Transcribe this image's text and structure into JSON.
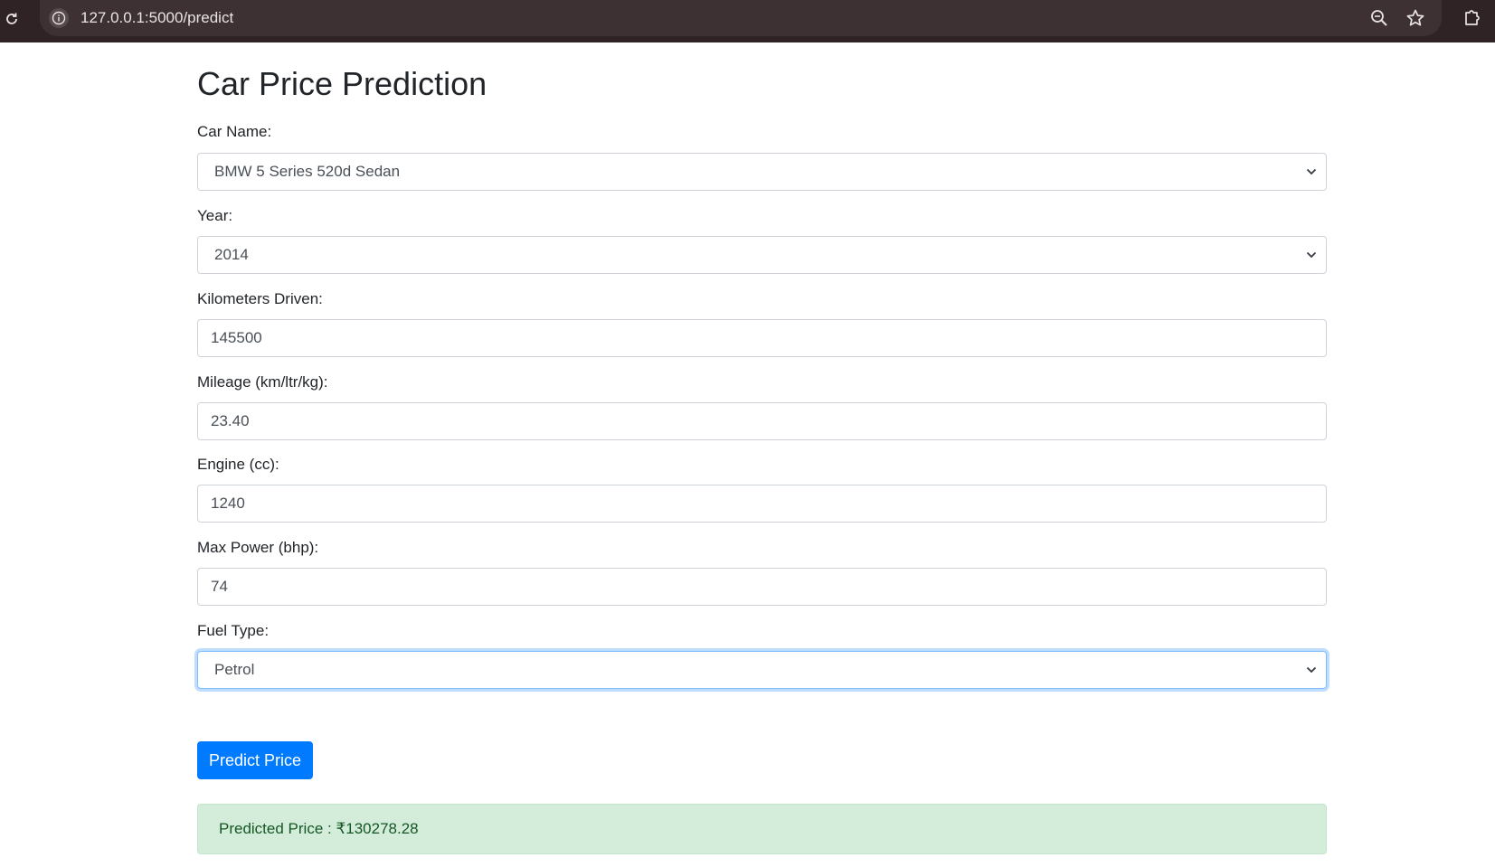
{
  "browser": {
    "url": "127.0.0.1:5000/predict"
  },
  "page": {
    "title": "Car Price Prediction"
  },
  "form": {
    "car_name": {
      "label": "Car Name:",
      "value": "BMW 5 Series 520d Sedan"
    },
    "year": {
      "label": "Year:",
      "value": "2014"
    },
    "km_driven": {
      "label": "Kilometers Driven:",
      "value": "145500"
    },
    "mileage": {
      "label": "Mileage (km/ltr/kg):",
      "value": "23.40"
    },
    "engine": {
      "label": "Engine (cc):",
      "value": "1240"
    },
    "max_power": {
      "label": "Max Power (bhp):",
      "value": "74"
    },
    "fuel_type": {
      "label": "Fuel Type:",
      "value": "Petrol"
    },
    "submit_label": "Predict Price"
  },
  "result": {
    "text": "Predicted Price : ₹130278.28"
  },
  "colors": {
    "primary": "#007bff",
    "alert_bg": "#d4edda",
    "alert_text": "#155724",
    "browser_bar": "#2f2325"
  },
  "icons": [
    "reload-icon",
    "info-icon",
    "zoom-icon",
    "star-icon",
    "extensions-icon",
    "chevron-down-icon"
  ]
}
